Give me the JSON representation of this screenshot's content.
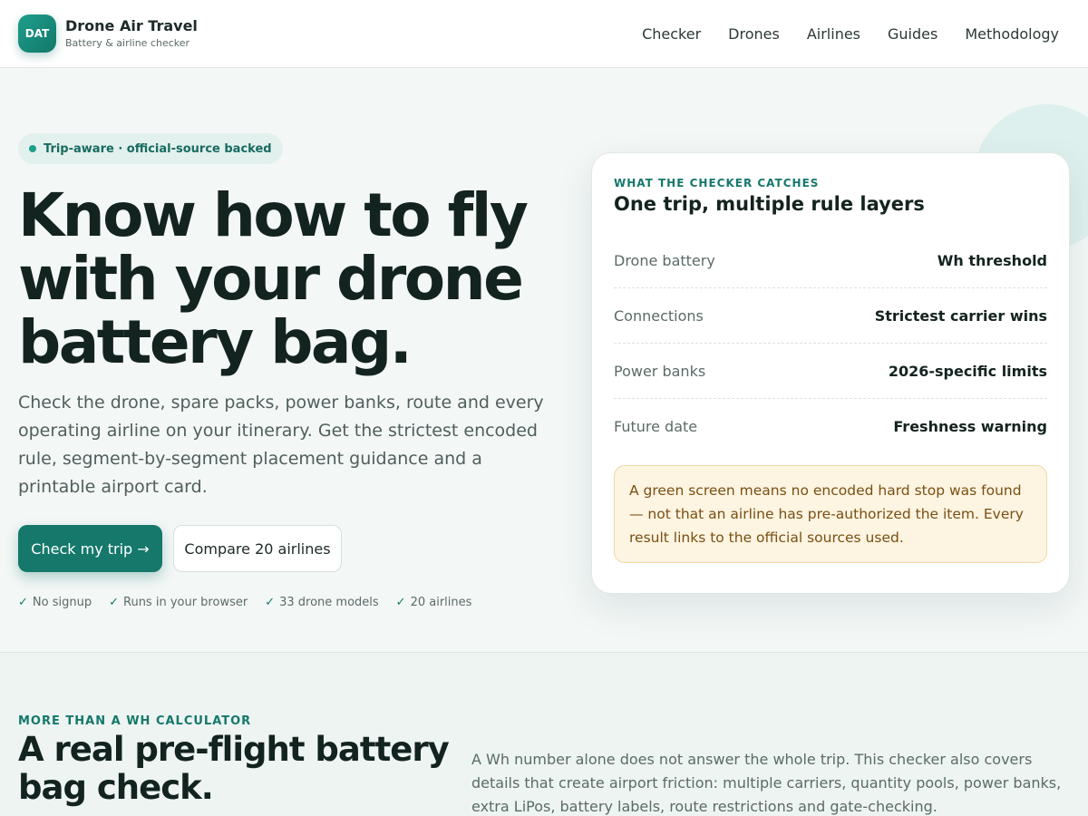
{
  "header": {
    "logo_text": "DAT",
    "brand_name": "Drone Air Travel",
    "brand_tagline": "Battery & airline checker",
    "nav": [
      "Checker",
      "Drones",
      "Airlines",
      "Guides",
      "Methodology"
    ]
  },
  "hero": {
    "pill_label": "Trip-aware · official-source backed",
    "headline_lines": [
      "Know how to fly",
      "with your drone",
      "battery bag."
    ],
    "lede": "Check the drone, spare packs, power banks, route and every operating airline on your itinerary. Get the strictest encoded rule, segment-by-segment placement guidance and a printable airport card.",
    "cta_primary": "Check my trip →",
    "cta_secondary": "Compare 20 airlines",
    "checks": [
      "No signup",
      "Runs in your browser",
      "33 drone models",
      "20 airlines"
    ]
  },
  "card": {
    "eyebrow": "WHAT THE CHECKER CATCHES",
    "title": "One trip, multiple rule layers",
    "rows": [
      {
        "key": "Drone battery",
        "value": "Wh threshold"
      },
      {
        "key": "Connections",
        "value": "Strictest carrier wins"
      },
      {
        "key": "Power banks",
        "value": "2026-specific limits"
      },
      {
        "key": "Future date",
        "value": "Freshness warning"
      }
    ],
    "note": "A green screen means no encoded hard stop was found — not that an airline has pre-authorized the item. Every result links to the official sources used."
  },
  "section2": {
    "eyebrow": "MORE THAN A WH CALCULATOR",
    "title": "A real pre-flight battery bag check.",
    "body": "A Wh number alone does not answer the whole trip. This checker also covers details that create airport friction: multiple carriers, quantity pools, power banks, extra LiPos, battery labels, route restrictions and gate-checking."
  },
  "colors": {
    "accent": "#15786b",
    "note_bg": "#fdf4e1",
    "note_text": "#7a4f12"
  }
}
